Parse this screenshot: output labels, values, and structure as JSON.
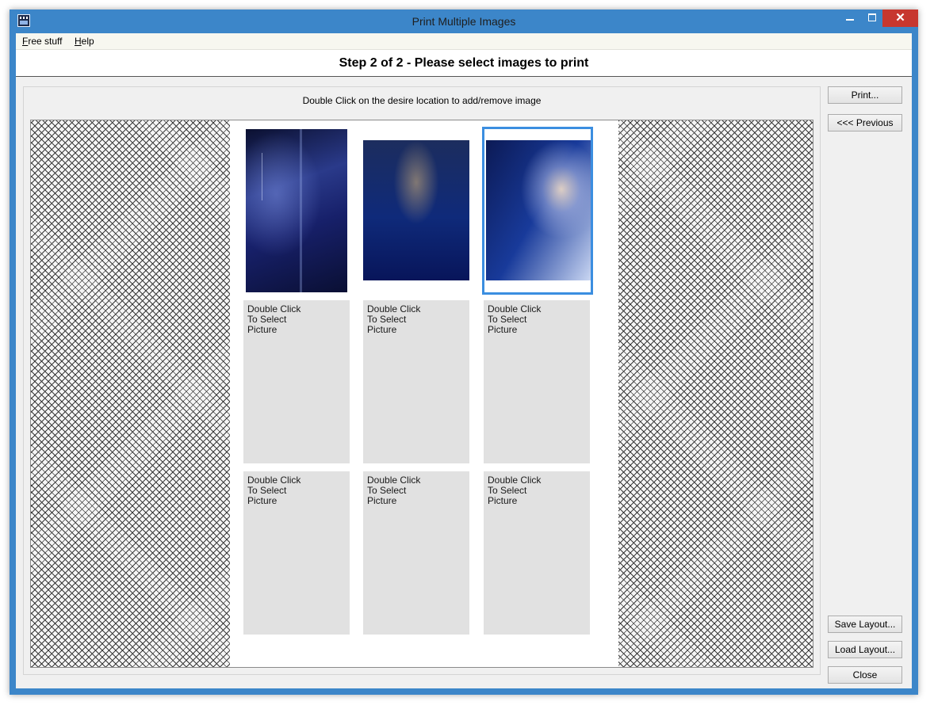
{
  "window": {
    "title": "Print Multiple Images",
    "close_glyph": "✕"
  },
  "menu": {
    "items": [
      {
        "mnemonic": "F",
        "rest": "ree stuff"
      },
      {
        "mnemonic": "H",
        "rest": "elp"
      }
    ]
  },
  "step_header": "Step 2 of 2 - Please select images to print",
  "instruction": "Double Click on the desire location to add/remove image",
  "slots": {
    "empty_label": "Double Click\nTo Select\nPicture",
    "filled": [
      {
        "icon": "poster-thumbnail-icon"
      },
      {
        "icon": "poster-thumbnail-icon"
      },
      {
        "icon": "poster-thumbnail-icon",
        "selected": true
      }
    ],
    "empty_count": 6
  },
  "buttons": {
    "print": "Print...",
    "previous": "<<< Previous",
    "save_layout": "Save Layout...",
    "load_layout": "Load Layout...",
    "close": "Close"
  },
  "colors": {
    "frame": "#3c86c9",
    "selection": "#3b8ee0",
    "close_button": "#c7372f",
    "empty_slot": "#e1e1e1"
  }
}
